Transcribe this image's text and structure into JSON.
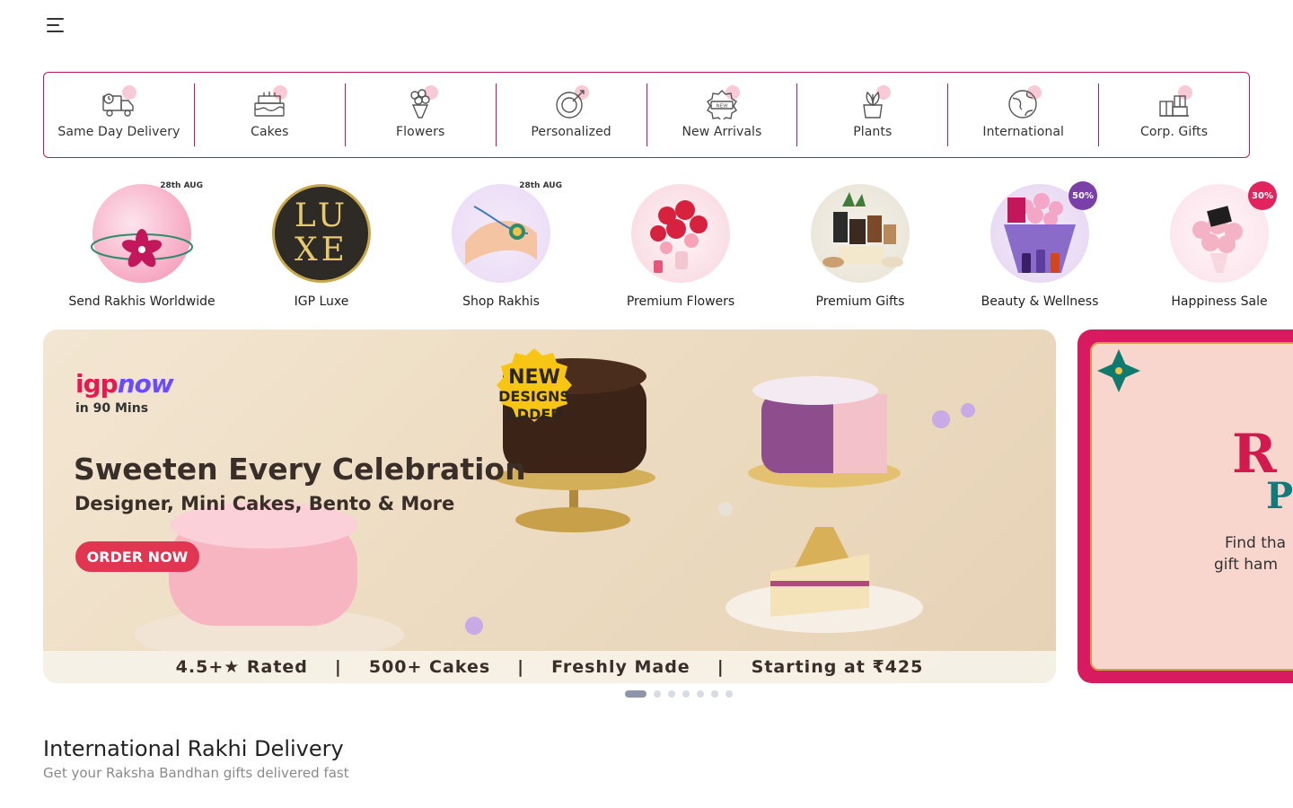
{
  "header": {
    "menu_icon": "hamburger-menu-icon"
  },
  "categories": [
    {
      "label": "Same Day Delivery",
      "icon": "delivery-truck-icon"
    },
    {
      "label": "Cakes",
      "icon": "cake-icon"
    },
    {
      "label": "Flowers",
      "icon": "flower-bouquet-icon"
    },
    {
      "label": "Personalized",
      "icon": "personalized-gift-icon"
    },
    {
      "label": "New Arrivals",
      "icon": "new-badge-icon"
    },
    {
      "label": "Plants",
      "icon": "plant-icon"
    },
    {
      "label": "International",
      "icon": "globe-icon"
    },
    {
      "label": "Corp. Gifts",
      "icon": "corporate-gift-icon"
    }
  ],
  "featured": [
    {
      "label": "Send Rakhis Worldwide",
      "date_tag": "28th AUG",
      "color": "#f48fb1"
    },
    {
      "label": "IGP Luxe",
      "logo_text_1": "LU",
      "logo_text_2": "XE",
      "color": "#2e2a25"
    },
    {
      "label": "Shop Rakhis",
      "date_tag": "28th AUG",
      "color": "#ead9f5"
    },
    {
      "label": "Premium Flowers",
      "color": "#f7d6de"
    },
    {
      "label": "Premium Gifts",
      "color": "#e8e2d4"
    },
    {
      "label": "Beauty & Wellness",
      "discount": "50%",
      "color": "#e5d4f1"
    },
    {
      "label": "Happiness Sale",
      "discount": "30%",
      "color": "#fbe1ea"
    }
  ],
  "banner": {
    "brand_main": "igp",
    "brand_accent": "now",
    "brand_sub": "in 90 Mins",
    "badge_line1": "NEW",
    "badge_line2": "DESIGNS",
    "badge_line3": "ADDED",
    "headline": "Sweeten Every Celebration",
    "subheadline": "Designer, Mini Cakes, Bento & More",
    "cta": "ORDER NOW",
    "strip": [
      "4.5+★ Rated",
      "|",
      "500+ Cakes",
      "|",
      "Freshly Made",
      "|",
      "Starting at ₹425"
    ]
  },
  "banner2": {
    "title_1": "R",
    "title_2": "P",
    "text_1": "Find tha",
    "text_2": "gift ham"
  },
  "carousel": {
    "total": 7,
    "active": 1
  },
  "section": {
    "title": "International Rakhi Delivery",
    "subtitle": "Get your Raksha Bandhan gifts delivered fast"
  },
  "colors": {
    "accent": "#c2185b",
    "cta": "#e03651"
  }
}
